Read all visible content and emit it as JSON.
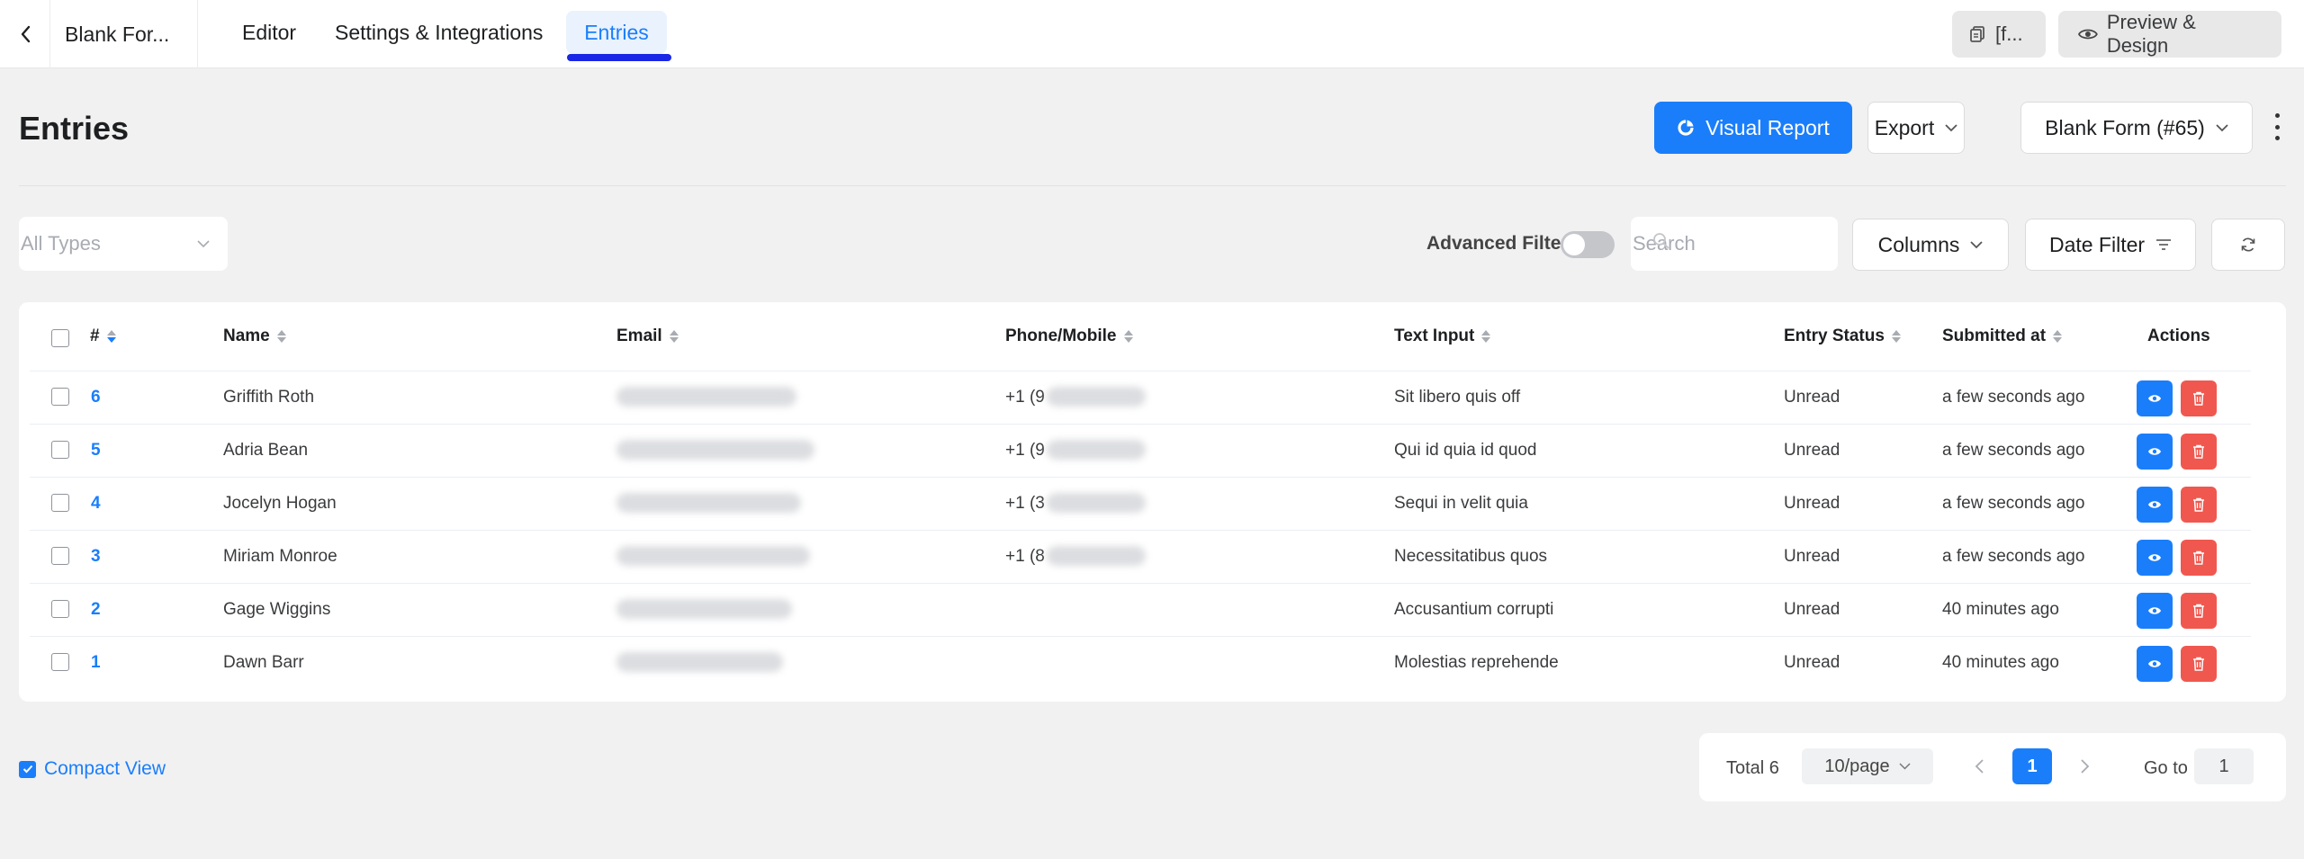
{
  "topbar": {
    "form_name": "Blank For...",
    "tabs": [
      {
        "label": "Editor"
      },
      {
        "label": "Settings & Integrations"
      },
      {
        "label": "Entries"
      }
    ],
    "shortcode_label": "[f...",
    "preview_label": "Preview & Design"
  },
  "header": {
    "title": "Entries",
    "visual_report_label": "Visual Report",
    "export_label": "Export",
    "form_selector_label": "Blank Form (#65)"
  },
  "filters": {
    "types_placeholder": "All Types",
    "advanced_filter_label": "Advanced Filter",
    "advanced_filter_on": false,
    "search_placeholder": "Search",
    "columns_label": "Columns",
    "date_filter_label": "Date Filter"
  },
  "table": {
    "columns": [
      "#",
      "Name",
      "Email",
      "Phone/Mobile",
      "Text Input",
      "Entry Status",
      "Submitted at",
      "Actions"
    ],
    "rows": [
      {
        "id": "6",
        "name": "Griffith Roth",
        "phone": "+1 (9",
        "text_input": "Sit libero quis off",
        "status": "Unread",
        "submitted": "a few seconds ago"
      },
      {
        "id": "5",
        "name": "Adria Bean",
        "phone": "+1 (9",
        "text_input": "Qui id quia id quod",
        "status": "Unread",
        "submitted": "a few seconds ago"
      },
      {
        "id": "4",
        "name": "Jocelyn Hogan",
        "phone": "+1 (3",
        "text_input": "Sequi in velit quia",
        "status": "Unread",
        "submitted": "a few seconds ago"
      },
      {
        "id": "3",
        "name": "Miriam Monroe",
        "phone": "+1 (8",
        "text_input": "Necessitatibus quos",
        "status": "Unread",
        "submitted": "a few seconds ago"
      },
      {
        "id": "2",
        "name": "Gage Wiggins",
        "phone": "",
        "text_input": "Accusantium corrupti",
        "status": "Unread",
        "submitted": "40 minutes ago"
      },
      {
        "id": "1",
        "name": "Dawn Barr",
        "phone": "",
        "text_input": "Molestias reprehende",
        "status": "Unread",
        "submitted": "40 minutes ago"
      }
    ]
  },
  "footer": {
    "compact_view_label": "Compact View",
    "compact_view_checked": true,
    "total_label": "Total 6",
    "page_size_label": "10/page",
    "current_page": "1",
    "goto_label": "Go to",
    "goto_value": "1"
  },
  "colors": {
    "accent": "#1a7efb",
    "danger": "#f0584f",
    "tab_underline": "#1a26e6",
    "background": "#f1f1f1"
  },
  "icons": [
    "chevron-left-icon",
    "copy-icon",
    "eye-icon",
    "pie-chart-icon",
    "chevron-down-icon",
    "kebab-icon",
    "search-icon",
    "filter-lines-icon",
    "refresh-icon",
    "sort-icon",
    "trash-icon",
    "check-icon",
    "chevron-right-icon"
  ]
}
